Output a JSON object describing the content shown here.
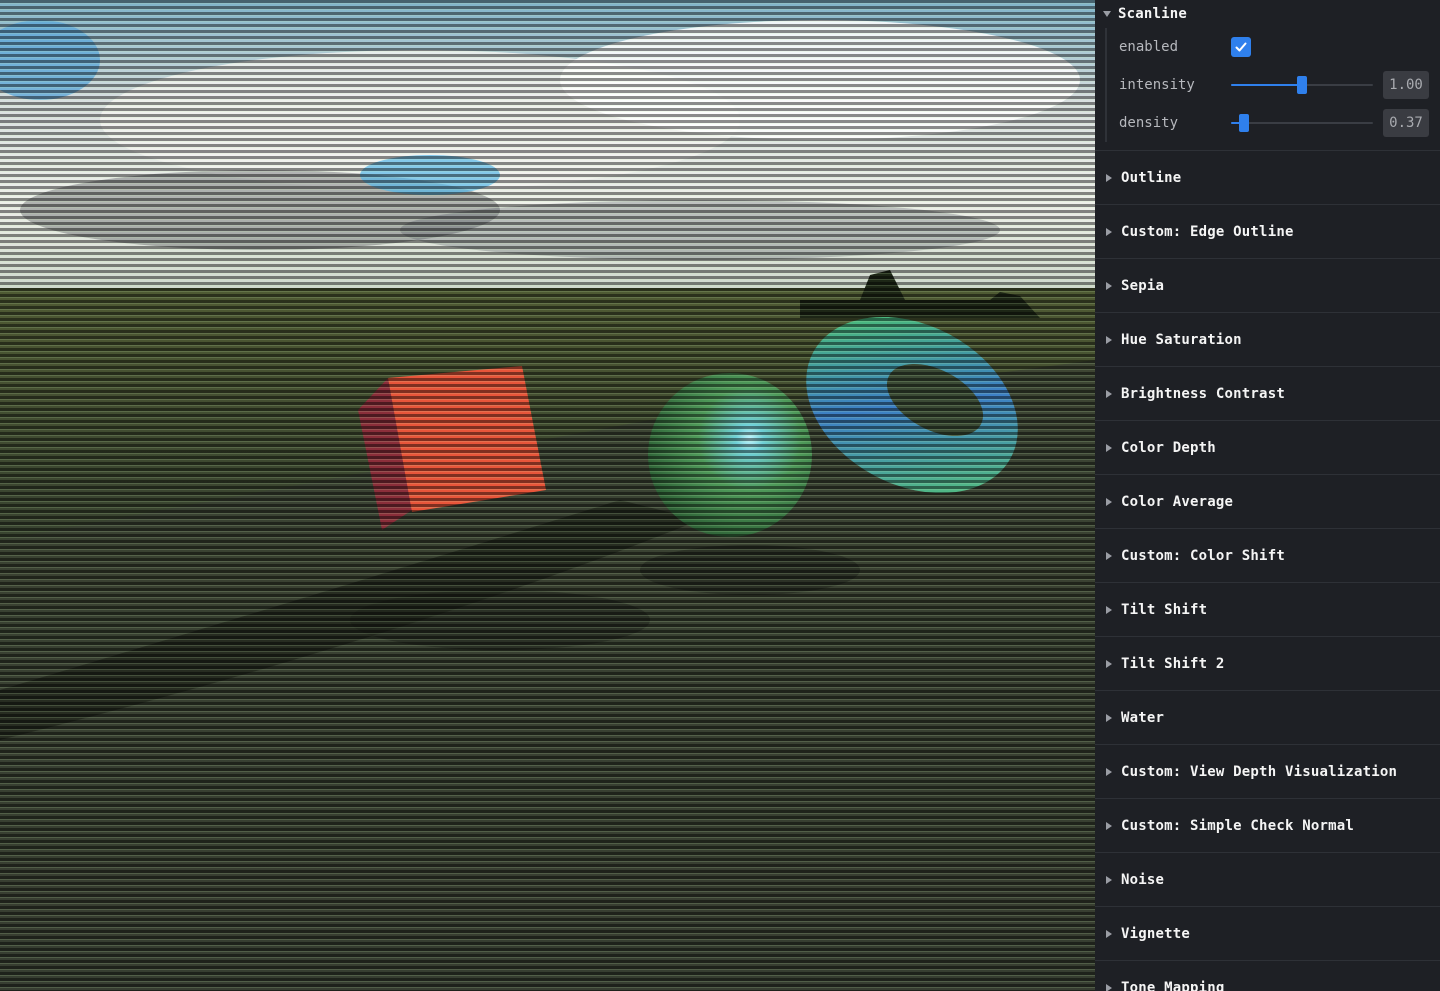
{
  "scanline": {
    "title": "Scanline",
    "enabled_label": "enabled",
    "enabled": true,
    "intensity_label": "intensity",
    "intensity_value": "1.00",
    "intensity_fraction": 0.5,
    "density_label": "density",
    "density_value": "0.37",
    "density_fraction": 0.09
  },
  "folders": [
    "Outline",
    "Custom: Edge Outline",
    "Sepia",
    "Hue Saturation",
    "Brightness Contrast",
    "Color Depth",
    "Color Average",
    "Custom: Color Shift",
    "Tilt Shift",
    "Tilt Shift 2",
    "Water",
    "Custom: View Depth Visualization",
    "Custom: Simple Check Normal",
    "Noise",
    "Vignette",
    "Tone Mapping"
  ],
  "scene": {
    "cube_color": "#e8553a",
    "sphere_color": "#4f9a5a",
    "torus_color": "#3d7fc6",
    "accent_color": "#2f80ed"
  }
}
